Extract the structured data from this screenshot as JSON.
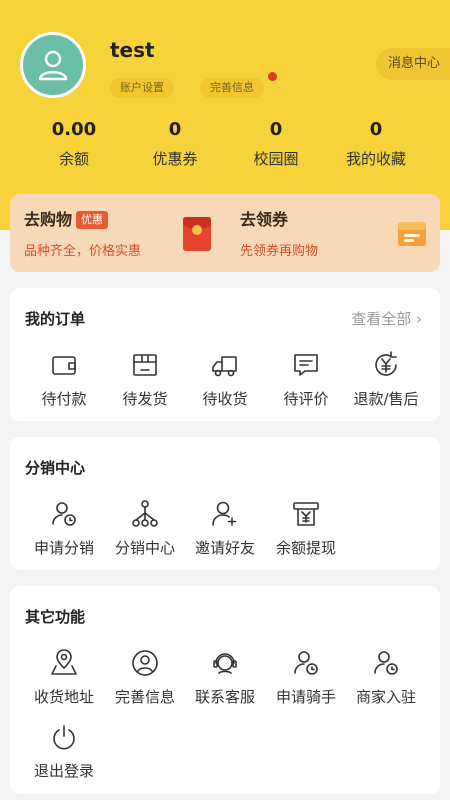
{
  "user": {
    "name": "test",
    "settings_tag": "账户设置",
    "info_tag": "完善信息",
    "message_center": "消息中心"
  },
  "stats": [
    {
      "value": "0.00",
      "label": "余额"
    },
    {
      "value": "0",
      "label": "优惠券"
    },
    {
      "value": "0",
      "label": "校园圈"
    },
    {
      "value": "0",
      "label": "我的收藏"
    }
  ],
  "promo": {
    "shop_title": "去购物",
    "shop_badge": "优惠",
    "shop_sub": "品种齐全，价格实惠",
    "coupon_title": "去领券",
    "coupon_sub": "先领券再购物"
  },
  "orders": {
    "title": "我的订单",
    "view_all": "查看全部 ›",
    "items": [
      {
        "label": "待付款",
        "icon": "wallet-icon"
      },
      {
        "label": "待发货",
        "icon": "box-icon"
      },
      {
        "label": "待收货",
        "icon": "truck-icon"
      },
      {
        "label": "待评价",
        "icon": "chat-icon"
      },
      {
        "label": "退款/售后",
        "icon": "refund-icon"
      }
    ]
  },
  "distribution": {
    "title": "分销中心",
    "items": [
      {
        "label": "申请分销",
        "icon": "user-clock-icon"
      },
      {
        "label": "分销中心",
        "icon": "network-icon"
      },
      {
        "label": "邀请好友",
        "icon": "user-plus-icon"
      },
      {
        "label": "余额提现",
        "icon": "withdraw-icon"
      }
    ]
  },
  "others": {
    "title": "其它功能",
    "items": [
      {
        "label": "收货地址",
        "icon": "map-pin-icon"
      },
      {
        "label": "完善信息",
        "icon": "user-circle-icon"
      },
      {
        "label": "联系客服",
        "icon": "headset-icon"
      },
      {
        "label": "申请骑手",
        "icon": "rider-icon"
      },
      {
        "label": "商家入驻",
        "icon": "merchant-icon"
      },
      {
        "label": "退出登录",
        "icon": "power-icon"
      }
    ]
  },
  "colors": {
    "header_bg": "#f6d33a",
    "promo_bg": "#f8d9b7",
    "badge_red": "#e45b32",
    "avatar_green": "#6bbfa6"
  }
}
